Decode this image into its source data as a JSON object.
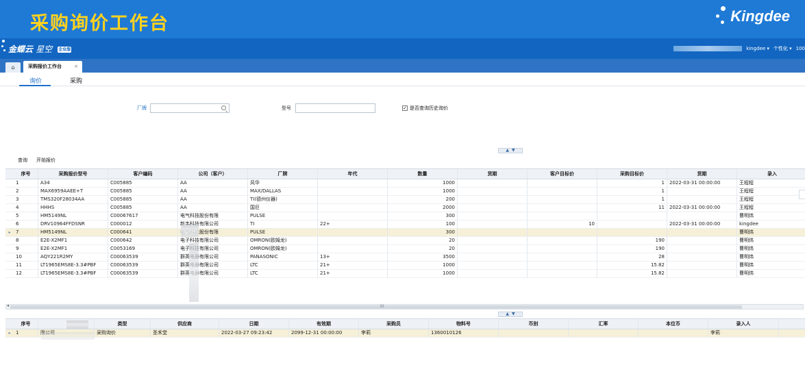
{
  "banner": {
    "title": "采购询价工作台",
    "logo_text": "Kingdee"
  },
  "app": {
    "logo_main": "金蝶云",
    "logo_sub": "星空",
    "badge": "企业版",
    "user": "kingdee",
    "personalize": "个性化",
    "zoom": "100",
    "dropdown": "▾"
  },
  "tabs": {
    "home_glyph": "⌂",
    "work_tab": "采购报价工作台",
    "close": "×"
  },
  "subtabs": [
    "询价",
    "采购"
  ],
  "filters": {
    "vendor_label": "厂牌",
    "model_label": "型号",
    "history_label": "是否查询历史询价",
    "history_checked": "✓"
  },
  "toolbar": {
    "query": "查询",
    "start_quote": "开始报价"
  },
  "collapse": {
    "up": "▲",
    "down": "▼"
  },
  "upper_grid": {
    "columns": [
      "序号",
      "采购报价型号",
      "客户编码",
      "公司（客户）",
      "厂牌",
      "年代",
      "数量",
      "货期",
      "客户目标价",
      "采购目标价",
      "货期",
      "录入"
    ],
    "rows": [
      {
        "marker": "",
        "cells": [
          "1",
          "A34",
          "C005885",
          "AA",
          "风华",
          "",
          "1000",
          "",
          "",
          "1",
          "2022-03-31 00:00:00",
          "王程程"
        ]
      },
      {
        "marker": "",
        "cells": [
          "2",
          "MAX6959AAEE+T",
          "C005885",
          "AA",
          "MAX/DALLAS",
          "",
          "1000",
          "",
          "",
          "1",
          "",
          "王程程"
        ]
      },
      {
        "marker": "",
        "cells": [
          "3",
          "TMS320F28034AA",
          "C005885",
          "AA",
          "TI(德州仪器)",
          "",
          "200",
          "",
          "",
          "1",
          "",
          "王程程"
        ]
      },
      {
        "marker": "",
        "cells": [
          "4",
          "HHHS",
          "C005885",
          "AA",
          "国巨",
          "",
          "2000",
          "",
          "",
          "11",
          "2022-03-31 00:00:00",
          "王程程"
        ]
      },
      {
        "marker": "",
        "cells": [
          "5",
          "HM5149NL",
          "C00067617",
          "电气科技股份有限",
          "PULSE",
          "",
          "300",
          "",
          "",
          "",
          "",
          "曹明炜"
        ]
      },
      {
        "marker": "",
        "cells": [
          "6",
          "DRV10964FFDSNR",
          "C000012",
          "新韦科技有限公司",
          "TI",
          "22+",
          "100",
          "",
          "10",
          "",
          "2022-03-31 00:00:00",
          "kingdee"
        ]
      },
      {
        "marker": "▸",
        "cells": [
          "7",
          "HM5149NL",
          "C000641",
          "电气科技股份有限",
          "PULSE",
          "",
          "300",
          "",
          "",
          "",
          "",
          "曹明炜"
        ]
      },
      {
        "marker": "",
        "cells": [
          "8",
          "E2E-X2MF1",
          "C000642",
          "电子科技有限公司",
          "OMRON(欧姆龙)",
          "",
          "20",
          "",
          "",
          "190",
          "",
          "曹明炜"
        ]
      },
      {
        "marker": "",
        "cells": [
          "9",
          "E2E-X2MF1",
          "C0053169",
          "电子科技有限公司",
          "OMRON(欧姆龙)",
          "",
          "20",
          "",
          "",
          "190",
          "",
          "曹明炜"
        ]
      },
      {
        "marker": "",
        "cells": [
          "10",
          "AQY221R2MY",
          "C00063539",
          "群英电器有限公司",
          "PANASONIC",
          "13+",
          "3500",
          "",
          "",
          "28",
          "",
          "曹明炜"
        ]
      },
      {
        "marker": "",
        "cells": [
          "11",
          "LT1965EMS8E-3.3#PBF",
          "C00063539",
          "群英电器有限公司",
          "LTC",
          "21+",
          "1000",
          "",
          "",
          "15.82",
          "",
          "曹明炜"
        ]
      },
      {
        "marker": "",
        "cells": [
          "12",
          "LT1965EMS8E-3.3#PBF",
          "C00063539",
          "群英电器有限公司",
          "LTC",
          "21+",
          "1000",
          "",
          "",
          "15.82",
          "",
          "曹明炜"
        ]
      }
    ]
  },
  "lower_grid": {
    "columns": [
      "序号",
      "",
      "类型",
      "供应商",
      "日期",
      "有效期",
      "采购员",
      "物料号",
      "币别",
      "汇率",
      "本位币",
      "录入人"
    ],
    "rows": [
      {
        "marker": "▸",
        "cells": [
          "1",
          "限公司",
          "采购询价",
          "圣禾堂",
          "2022-03-27 09:23:42",
          "2099-12-31 00:00:00",
          "李莉",
          "1360010126",
          "",
          "",
          "",
          "李莉"
        ]
      }
    ]
  },
  "scroll": {
    "left_arrow": "◂",
    "grip": "III"
  }
}
